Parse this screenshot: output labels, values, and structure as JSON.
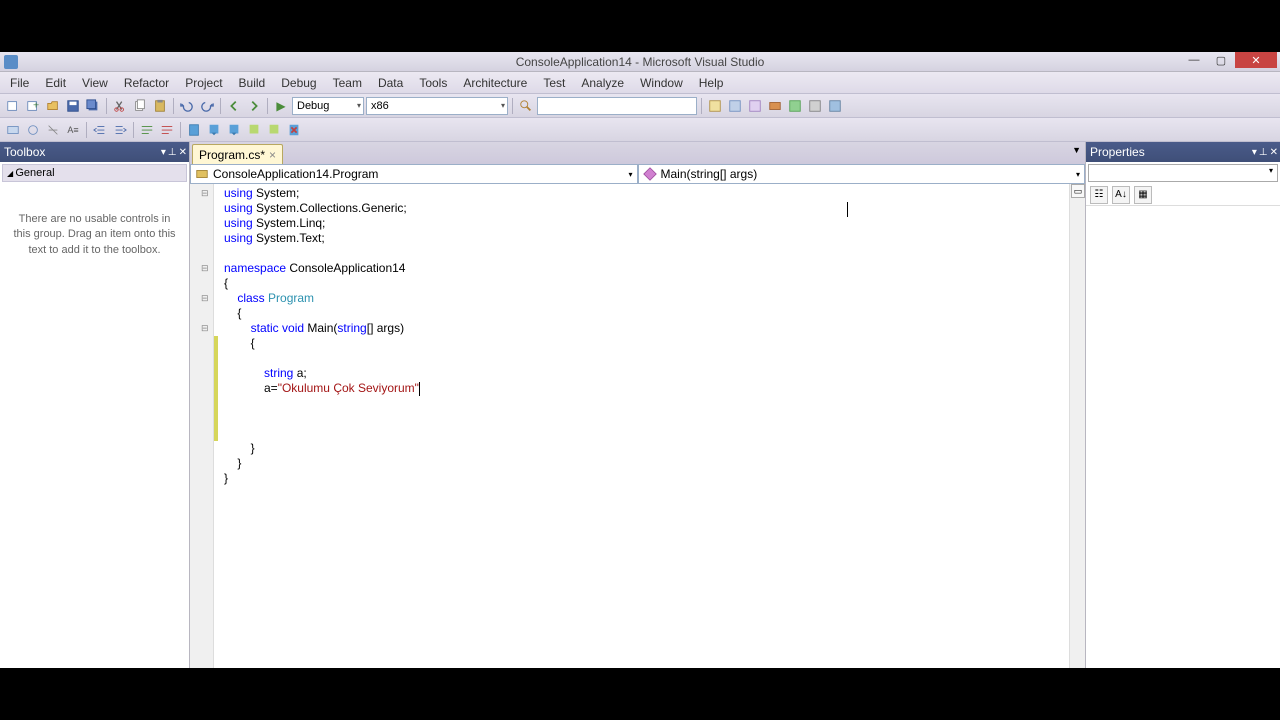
{
  "titlebar": {
    "title": "ConsoleApplication14 - Microsoft Visual Studio"
  },
  "menubar": [
    "File",
    "Edit",
    "View",
    "Refactor",
    "Project",
    "Build",
    "Debug",
    "Team",
    "Data",
    "Tools",
    "Architecture",
    "Test",
    "Analyze",
    "Window",
    "Help"
  ],
  "toolbar": {
    "config": "Debug",
    "platform": "x86",
    "search": ""
  },
  "toolbox": {
    "title": "Toolbox",
    "group": "General",
    "empty": "There are no usable controls in this group. Drag an item onto this text to add it to the toolbox."
  },
  "tabs": {
    "active": "Program.cs*"
  },
  "nav": {
    "class": "ConsoleApplication14.Program",
    "member": "Main(string[] args)"
  },
  "code": {
    "l1a": "using",
    "l1b": " System;",
    "l2a": "using",
    "l2b": " System.Collections.Generic;",
    "l3a": "using",
    "l3b": " System.Linq;",
    "l4a": "using",
    "l4b": " System.Text;",
    "l6a": "namespace",
    "l6b": " ConsoleApplication14",
    "l7": "{",
    "l8a": "    ",
    "l8b": "class",
    "l8c": " ",
    "l8d": "Program",
    "l9": "    {",
    "l10a": "        ",
    "l10b": "static",
    "l10c": " ",
    "l10d": "void",
    "l10e": " Main(",
    "l10f": "string",
    "l10g": "[] args)",
    "l11": "        {",
    "l13a": "            ",
    "l13b": "string",
    "l13c": " a;",
    "l14a": "            a=",
    "l14b": "\"Okulumu Çok Seviyorum\"",
    "l18": "        }",
    "l19": "    }",
    "l20": "}"
  },
  "properties": {
    "title": "Properties"
  }
}
